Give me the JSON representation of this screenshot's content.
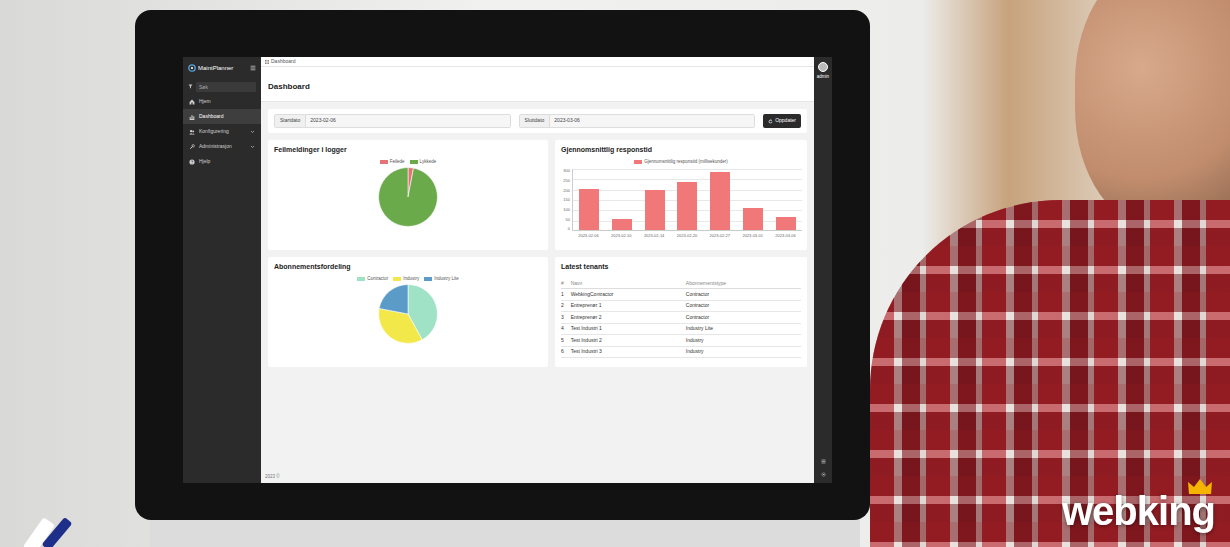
{
  "app": {
    "brand": "MaintPlanner",
    "search": {
      "placeholder": "Søk"
    },
    "sidebar": {
      "items": [
        {
          "label": "Hjem",
          "selected": false,
          "expandable": false
        },
        {
          "label": "Dashboard",
          "selected": true,
          "expandable": false
        },
        {
          "label": "Konfigurering",
          "selected": false,
          "expandable": true
        },
        {
          "label": "Administrasjon",
          "selected": false,
          "expandable": true
        },
        {
          "label": "Hjelp",
          "selected": false,
          "expandable": false
        }
      ]
    },
    "breadcrumb": "Dashboard",
    "page_title": "Dashboard",
    "filters": [
      {
        "label": "Startdato",
        "value": "2023-02-06"
      },
      {
        "label": "Sluttdato",
        "value": "2023-03-06"
      }
    ],
    "refresh_button": "Oppdater",
    "user": "admin",
    "error_chart": {
      "title": "Feilmeldinger i logger",
      "series": [
        {
          "label": "Feilede",
          "value": 3,
          "color": "#e57373"
        },
        {
          "label": "Lykkede",
          "value": 97,
          "color": "#6aaa4b"
        }
      ]
    },
    "response_chart": {
      "title": "Gjennomsnittlig responstid",
      "legend": "Gjennomsnittlig responstid (millisekunder)",
      "color": "#f07878",
      "y_ticks": [
        "300",
        "250",
        "200",
        "150",
        "100",
        "50",
        "0"
      ],
      "labels": [
        "2023-02-06",
        "2023-02-10",
        "2023-02-14",
        "2023-02-20",
        "2023-02-27",
        "2023-03-01",
        "2023-03-06"
      ],
      "values": [
        205,
        55,
        200,
        238,
        285,
        110,
        65
      ]
    },
    "subscription_chart": {
      "title": "Abonnementsfordeling",
      "series": [
        {
          "label": "Contractor",
          "value": 42,
          "color": "#9fe2c6"
        },
        {
          "label": "Industry",
          "value": 36,
          "color": "#f2e84a"
        },
        {
          "label": "Industry Lite",
          "value": 22,
          "color": "#5b9bc8"
        }
      ]
    },
    "tenants": {
      "title": "Latest tenants",
      "columns": [
        "#",
        "Navn",
        "Abonnementstype"
      ],
      "rows": [
        [
          "1",
          "WebkingContractor",
          "Contractor"
        ],
        [
          "2",
          "Entreprenør 1",
          "Contractor"
        ],
        [
          "3",
          "Entreprenør 2",
          "Contractor"
        ],
        [
          "4",
          "Test Industri 1",
          "Industry Lite"
        ],
        [
          "5",
          "Test Industri 2",
          "Industry"
        ],
        [
          "6",
          "Test Industri 3",
          "Industry"
        ]
      ]
    },
    "footer": "2023 ©"
  },
  "brand_logo": "webking"
}
